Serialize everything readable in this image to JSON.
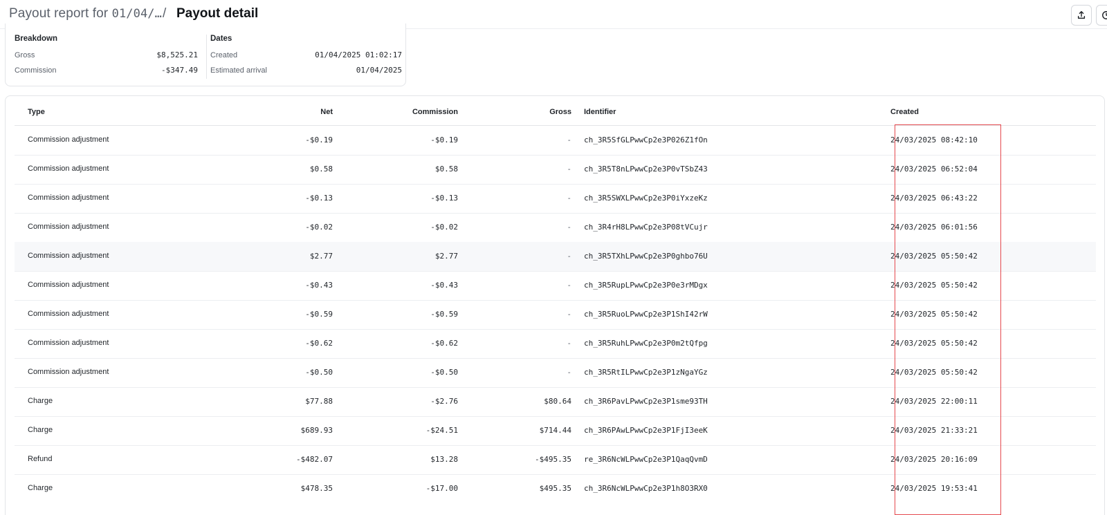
{
  "header": {
    "breadcrumb_parent_prefix": "Payout report for",
    "breadcrumb_parent_date": "01/04/…",
    "separator": "/",
    "title": "Payout detail"
  },
  "summary": {
    "breakdown": {
      "title": "Breakdown",
      "rows": [
        {
          "label": "Gross",
          "value": "$8,525.21"
        },
        {
          "label": "Commission",
          "value": "-$347.49"
        }
      ]
    },
    "dates": {
      "title": "Dates",
      "rows": [
        {
          "label": "Created",
          "value": "01/04/2025 01:02:17"
        },
        {
          "label": "Estimated arrival",
          "value": "01/04/2025"
        }
      ]
    }
  },
  "table": {
    "columns": {
      "type": "Type",
      "net": "Net",
      "commission": "Commission",
      "gross": "Gross",
      "identifier": "Identifier",
      "created": "Created"
    },
    "rows": [
      {
        "type": "Commission adjustment",
        "net": "-$0.19",
        "commission": "-$0.19",
        "gross": "-",
        "identifier": "ch_3R5SfGLPwwCp2e3P026Z1fOn",
        "created": "24/03/2025 08:42:10"
      },
      {
        "type": "Commission adjustment",
        "net": "$0.58",
        "commission": "$0.58",
        "gross": "-",
        "identifier": "ch_3R5T8nLPwwCp2e3P0vTSbZ43",
        "created": "24/03/2025 06:52:04"
      },
      {
        "type": "Commission adjustment",
        "net": "-$0.13",
        "commission": "-$0.13",
        "gross": "-",
        "identifier": "ch_3R5SWXLPwwCp2e3P0iYxzeKz",
        "created": "24/03/2025 06:43:22"
      },
      {
        "type": "Commission adjustment",
        "net": "-$0.02",
        "commission": "-$0.02",
        "gross": "-",
        "identifier": "ch_3R4rH8LPwwCp2e3P08tVCujr",
        "created": "24/03/2025 06:01:56"
      },
      {
        "type": "Commission adjustment",
        "net": "$2.77",
        "commission": "$2.77",
        "gross": "-",
        "identifier": "ch_3R5TXhLPwwCp2e3P0ghbo76U",
        "created": "24/03/2025 05:50:42"
      },
      {
        "type": "Commission adjustment",
        "net": "-$0.43",
        "commission": "-$0.43",
        "gross": "-",
        "identifier": "ch_3R5RupLPwwCp2e3P0e3rMDgx",
        "created": "24/03/2025 05:50:42"
      },
      {
        "type": "Commission adjustment",
        "net": "-$0.59",
        "commission": "-$0.59",
        "gross": "-",
        "identifier": "ch_3R5RuoLPwwCp2e3P1ShI42rW",
        "created": "24/03/2025 05:50:42"
      },
      {
        "type": "Commission adjustment",
        "net": "-$0.62",
        "commission": "-$0.62",
        "gross": "-",
        "identifier": "ch_3R5RuhLPwwCp2e3P0m2tQfpg",
        "created": "24/03/2025 05:50:42"
      },
      {
        "type": "Commission adjustment",
        "net": "-$0.50",
        "commission": "-$0.50",
        "gross": "-",
        "identifier": "ch_3R5RtILPwwCp2e3P1zNgaYGz",
        "created": "24/03/2025 05:50:42"
      },
      {
        "type": "Charge",
        "net": "$77.88",
        "commission": "-$2.76",
        "gross": "$80.64",
        "identifier": "ch_3R6PavLPwwCp2e3P1sme93TH",
        "created": "24/03/2025 22:00:11"
      },
      {
        "type": "Charge",
        "net": "$689.93",
        "commission": "-$24.51",
        "gross": "$714.44",
        "identifier": "ch_3R6PAwLPwwCp2e3P1FjI3eeK",
        "created": "24/03/2025 21:33:21"
      },
      {
        "type": "Refund",
        "net": "-$482.07",
        "commission": "$13.28",
        "gross": "-$495.35",
        "identifier": "re_3R6NcWLPwwCp2e3P1QaqQvmD",
        "created": "24/03/2025 20:16:09"
      },
      {
        "type": "Charge",
        "net": "$478.35",
        "commission": "-$17.00",
        "gross": "$495.35",
        "identifier": "ch_3R6NcWLPwwCp2e3P1h8O3RX0",
        "created": "24/03/2025 19:53:41"
      }
    ]
  },
  "icons": {
    "export": "upload-icon",
    "more": "clock-icon"
  },
  "colors": {
    "highlight_border": "#e5484d",
    "border": "#e3e5e8",
    "text_primary": "#1f2328",
    "text_secondary": "#5b616b"
  }
}
